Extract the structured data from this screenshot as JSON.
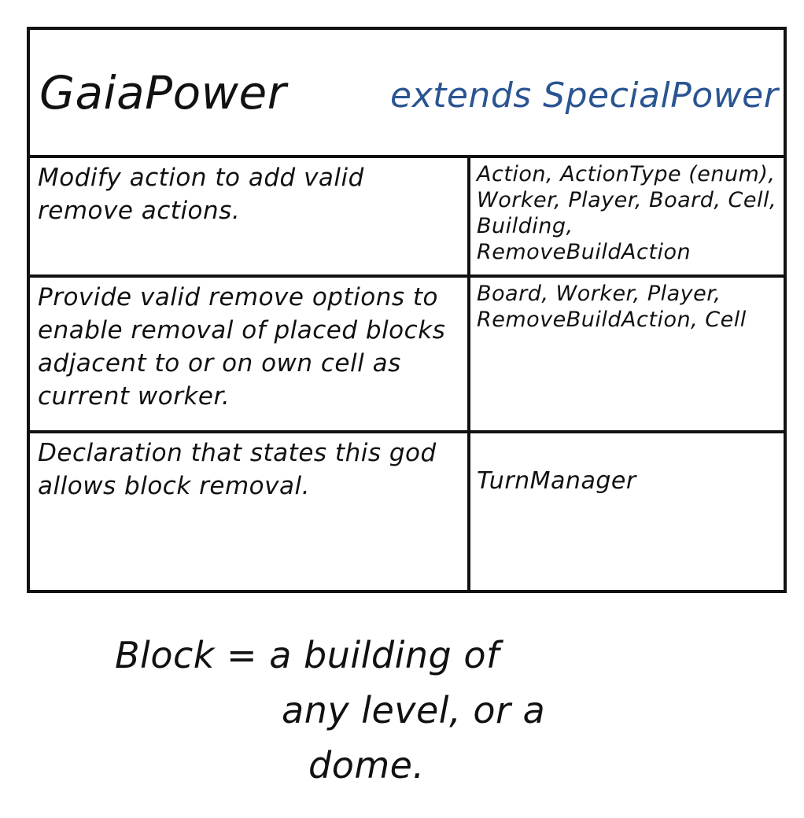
{
  "card": {
    "class_name": "GaiaPower",
    "superclass": "extends SpecialPower",
    "rows": [
      {
        "responsibility": "Modify action to add valid remove actions.",
        "collaborators": "Action, ActionType (enum), Worker, Player, Board, Cell, Building, RemoveBuildAction"
      },
      {
        "responsibility": "Provide valid remove options to enable removal of placed blocks adjacent to or on own cell as current worker.",
        "collaborators": "Board, Worker, Player, RemoveBuildAction, Cell"
      },
      {
        "responsibility": "Declaration that states this god allows block removal.",
        "collaborators": "TurnManager"
      }
    ]
  },
  "note": {
    "line1": "Block = a building of",
    "line2": "any level, or a",
    "line3": "dome."
  },
  "colors": {
    "ink": "#111111",
    "blue_ink": "#2a5592",
    "background": "#ffffff"
  }
}
